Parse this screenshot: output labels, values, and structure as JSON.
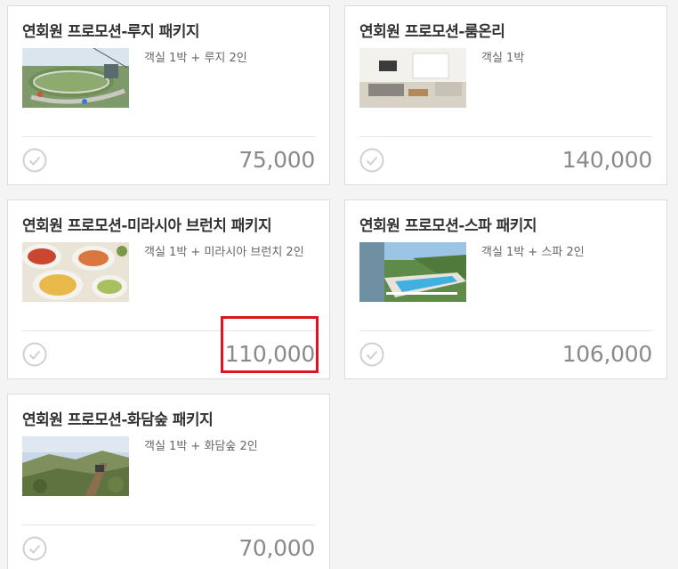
{
  "packages": [
    {
      "title": "연회원 프로모션-루지 패키지",
      "description": "객실 1박 + 루지 2인",
      "price": "75,000",
      "image_icon": "luge-track-photo",
      "check_icon": "check-circle-icon"
    },
    {
      "title": "연회원 프로모션-룸온리",
      "description": "객실 1박",
      "price": "140,000",
      "image_icon": "room-interior-photo",
      "check_icon": "check-circle-icon"
    },
    {
      "title": "연회원 프로모션-미라시아 브런치 패키지",
      "description": "객실 1박 + 미라시아 브런치 2인",
      "price": "110,000",
      "image_icon": "brunch-food-photo",
      "check_icon": "check-circle-icon"
    },
    {
      "title": "연회원 프로모션-스파 패키지",
      "description": "객실 1박 + 스파 2인",
      "price": "106,000",
      "image_icon": "outdoor-pool-photo",
      "check_icon": "check-circle-icon"
    },
    {
      "title": "연회원 프로모션-화담숲 패키지",
      "description": "객실 1박 + 화담숲 2인",
      "price": "70,000",
      "image_icon": "forest-monorail-photo",
      "check_icon": "check-circle-icon"
    }
  ],
  "colors": {
    "background": "#f4f4f4",
    "card": "#ffffff",
    "title_text": "#333333",
    "price_text": "#8a8a8a",
    "highlight": "#e0141e"
  }
}
